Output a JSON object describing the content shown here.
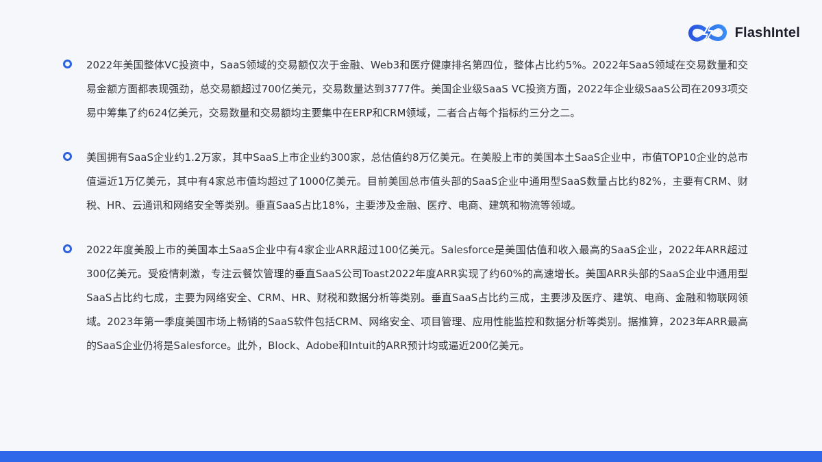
{
  "header": {
    "logo_text": "FlashIntel",
    "logo_icon": "infinity-lightning-icon",
    "accent_color": "#2d63dc"
  },
  "paragraphs": [
    {
      "text": "2022年美国整体VC投资中，SaaS领域的交易额仅次于金融、Web3和医疗健康排名第四位，整体占比约5%。2022年SaaS领域在交易数量和交易金额方面都表现强劲，总交易额超过700亿美元，交易数量达到3777件。美国企业级SaaS VC投资方面，2022年企业级SaaS公司在2093项交易中筹集了约624亿美元，交易数量和交易额均主要集中在ERP和CRM领域，二者合占每个指标约三分之二。"
    },
    {
      "text": "美国拥有SaaS企业约1.2万家，其中SaaS上市企业约300家，总估值约8万亿美元。在美股上市的美国本土SaaS企业中，市值TOP10企业的总市值逼近1万亿美元，其中有4家总市值均超过了1000亿美元。目前美国总市值头部的SaaS企业中通用型SaaS数量占比约82%，主要有CRM、财税、HR、云通讯和网络安全等类别。垂直SaaS占比18%，主要涉及金融、医疗、电商、建筑和物流等领域。"
    },
    {
      "text": "2022年度美股上市的美国本土SaaS企业中有4家企业ARR超过100亿美元。Salesforce是美国估值和收入最高的SaaS企业，2022年ARR超过300亿美元。受疫情刺激，专注云餐饮管理的垂直SaaS公司Toast2022年度ARR实现了约60%的高速增长。美国ARR头部的SaaS企业中通用型SaaS占比约七成，主要为网络安全、CRM、HR、财税和数据分析等类别。垂直SaaS占比约三成，主要涉及医疗、建筑、电商、金融和物联网领域。2023年第一季度美国市场上畅销的SaaS软件包括CRM、网络安全、项目管理、应用性能监控和数据分析等类别。据推算，2023年ARR最高的SaaS企业仍将是Salesforce。此外，Block、Adobe和Intuit的ARR预计均或逼近200亿美元。"
    }
  ],
  "footer": {
    "bar_color": "#2f68e8"
  }
}
